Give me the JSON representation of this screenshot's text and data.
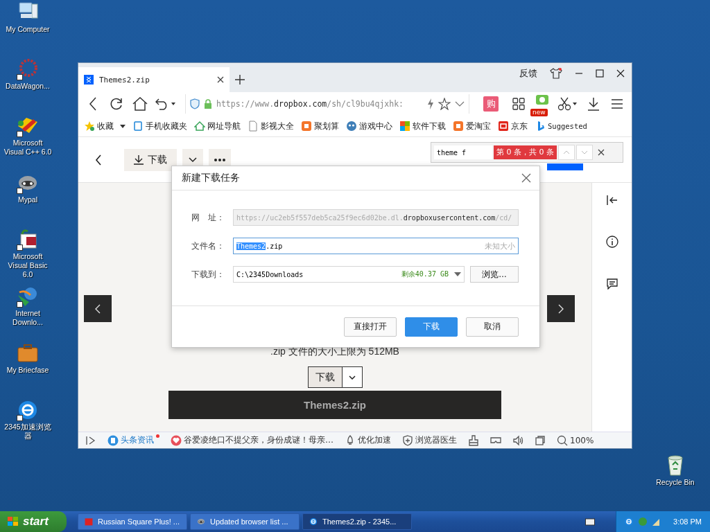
{
  "desktop_icons": [
    {
      "label": "My Computer",
      "kind": "computer",
      "shortcut": false
    },
    {
      "label": "DataWagon...",
      "kind": "datawagon",
      "shortcut": true
    },
    {
      "label": "Microsoft Visual C++ 6.0",
      "kind": "vcpp",
      "shortcut": true
    },
    {
      "label": "Mypal",
      "kind": "mypal",
      "shortcut": true
    },
    {
      "label": "Microsoft Visual Basic 6.0",
      "kind": "vb",
      "shortcut": true
    },
    {
      "label": "Internet Downlo...",
      "kind": "idm",
      "shortcut": true
    },
    {
      "label": "My Briecfase",
      "kind": "briefcase",
      "shortcut": false
    },
    {
      "label": "2345加速浏览器",
      "kind": "browser",
      "shortcut": true
    }
  ],
  "recycle_bin": {
    "label": "Recycle Bin"
  },
  "browser": {
    "tabs": [
      {
        "title": "Themes2.zip",
        "selected": true
      }
    ],
    "feedback_label": "反馈",
    "url": "https://www.**dropbox.com**/sh/cl9bu4qjxhk:",
    "shop_label": "购",
    "new_badge": "new",
    "bookmarks": [
      {
        "label": "收藏",
        "kind": "favorites"
      },
      {
        "label": "手机收藏夹",
        "kind": "phone"
      },
      {
        "label": "网址导航",
        "kind": "nav"
      },
      {
        "label": "影视大全",
        "kind": "doc"
      },
      {
        "label": "聚划算",
        "kind": "taobao"
      },
      {
        "label": "游戏中心",
        "kind": "game"
      },
      {
        "label": "软件下载",
        "kind": "windows"
      },
      {
        "label": "爱淘宝",
        "kind": "taobao"
      },
      {
        "label": "京东",
        "kind": "jd"
      },
      {
        "label": "Suggested",
        "kind": "bing"
      }
    ],
    "page": {
      "download_button": "下载",
      "size_note": ".zip 文件的大小上限为 512MB",
      "split_download": "下载",
      "file_bar": "Themes2.zip"
    },
    "find_bar": {
      "value": "theme f",
      "result": "第 0 条，共 0 条"
    },
    "dialog": {
      "title": "新建下载任务",
      "url_label": "网　址：",
      "url": "https://uc2eb5f557deb5ca25f9ec6d02be.dl.**dropboxusercontent.com**/cd/",
      "name_label": "文件名：",
      "name_selected": "Themes2",
      "name_rest": ".zip",
      "size": "未知大小",
      "dest_label": "下载到：",
      "dest": "C:\\2345Downloads",
      "free_space": "剩余40.37 GB",
      "browse": "浏览…",
      "buttons": [
        {
          "label": "直接打开",
          "primary": false
        },
        {
          "label": "下载",
          "primary": true
        },
        {
          "label": "取消",
          "primary": false
        }
      ]
    },
    "status_bar": [
      {
        "kind": "sidebar-toggle"
      },
      {
        "kind": "news",
        "label": "头条资讯",
        "dot": true
      },
      {
        "kind": "headline",
        "label": "谷爱凌绝口不提父亲，身份成谜！母亲…"
      },
      {
        "kind": "speed",
        "label": "优化加速"
      },
      {
        "kind": "doctor",
        "label": "浏览器医生"
      },
      {
        "kind": "clean"
      },
      {
        "kind": "vr"
      },
      {
        "kind": "sound"
      },
      {
        "kind": "window"
      },
      {
        "kind": "zoom",
        "label": "100%"
      }
    ]
  },
  "taskbar": {
    "start": "start",
    "tasks": [
      {
        "label": "Russian Square Plus! ...",
        "kind": "game",
        "selected": false
      },
      {
        "label": "Updated browser list ...",
        "kind": "mypal",
        "selected": false
      },
      {
        "label": "Themes2.zip - 2345...",
        "kind": "browser",
        "selected": true
      }
    ],
    "clock": "3:08 PM"
  }
}
